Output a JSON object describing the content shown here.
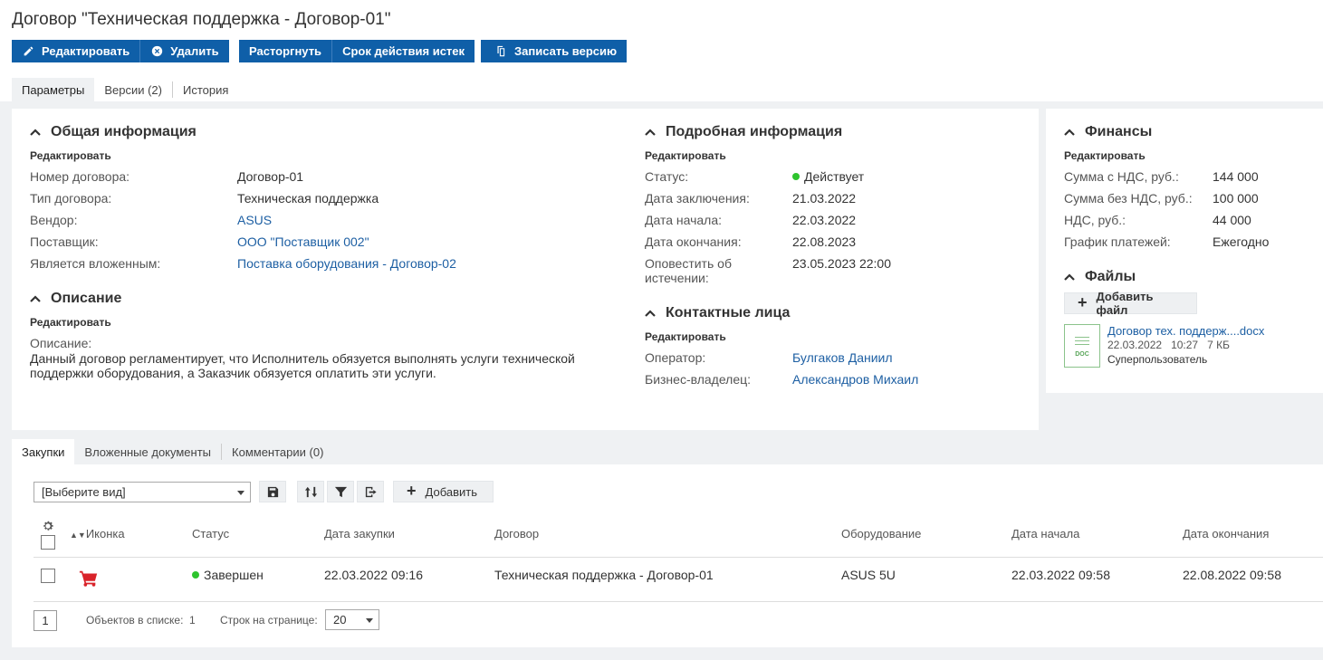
{
  "page": {
    "title": "Договор \"Техническая поддержка - Договор-01\""
  },
  "toolbar": {
    "edit": "Редактировать",
    "delete": "Удалить",
    "terminate": "Расторгнуть",
    "expired": "Срок действия истек",
    "save_version": "Записать версию"
  },
  "tabs": {
    "params": "Параметры",
    "versions": "Версии (2)",
    "history": "История"
  },
  "general": {
    "title": "Общая информация",
    "edit": "Редактировать",
    "rows": [
      {
        "label": "Номер договора:",
        "value": "Договор-01"
      },
      {
        "label": "Тип договора:",
        "value": "Техническая поддержка"
      },
      {
        "label": "Вендор:",
        "value": "ASUS"
      },
      {
        "label": "Поставщик:",
        "value": "ООО \"Поставщик 002\""
      },
      {
        "label": "Является вложенным:",
        "value": "Поставка оборудования - Договор-02"
      }
    ]
  },
  "description": {
    "title": "Описание",
    "edit": "Редактировать",
    "label": "Описание:",
    "text_line1": "Данный договор регламентирует, что Исполнитель обязуется выполнять услуги технической",
    "text_line2": "поддержки оборудования, а Заказчик обязуется оплатить эти услуги."
  },
  "details": {
    "title": "Подробная информация",
    "edit": "Редактировать",
    "rows": [
      {
        "label": "Статус:",
        "value": "Действует"
      },
      {
        "label": "Дата заключения:",
        "value": "21.03.2022"
      },
      {
        "label": "Дата начала:",
        "value": "22.03.2022"
      },
      {
        "label": "Дата окончания:",
        "value": "22.08.2023"
      },
      {
        "label": "Оповестить об",
        "label2": "истечении:",
        "value": "23.05.2023 22:00"
      }
    ],
    "status_color": "#2ec42e"
  },
  "contacts": {
    "title": "Контактные лица",
    "edit": "Редактировать",
    "rows": [
      {
        "label": "Оператор:",
        "value": "Булгаков Даниил"
      },
      {
        "label": "Бизнес-владелец:",
        "value": "Александров Михаил"
      }
    ]
  },
  "finance": {
    "title": "Финансы",
    "edit": "Редактировать",
    "rows": [
      {
        "label": "Сумма с НДС, руб.:",
        "value": "144 000"
      },
      {
        "label": "Сумма без НДС, руб.:",
        "value": "100 000"
      },
      {
        "label": "НДС, руб.:",
        "value": "44 000"
      },
      {
        "label": "График платежей:",
        "value": "Ежегодно"
      }
    ]
  },
  "files": {
    "title": "Файлы",
    "add_file": "Добавить файл",
    "file": {
      "icon_text": "DOC",
      "name": "Договор тех. поддерж....docx",
      "date": "22.03.2022",
      "time": "10:27",
      "size": "7 КБ",
      "author": "Суперпользователь"
    }
  },
  "bottom_tabs": {
    "purchases": "Закупки",
    "nested": "Вложенные документы",
    "comments": "Комментарии (0)"
  },
  "grid": {
    "view_placeholder": "[Выберите вид]",
    "add": "Добавить",
    "columns": {
      "icon": "Иконка",
      "status": "Статус",
      "date": "Дата закупки",
      "contract": "Договор",
      "equipment": "Оборудование",
      "start": "Дата начала",
      "end": "Дата окончания"
    },
    "row": {
      "status": "Завершен",
      "date": "22.03.2022 09:16",
      "contract": "Техническая поддержка - Договор-01",
      "equipment": "ASUS 5U",
      "start": "22.03.2022 09:58",
      "end": "22.08.2022 09:58"
    },
    "pager": {
      "page": "1",
      "objects_label": "Объектов в списке:",
      "objects_count": "1",
      "rows_label": "Строк на странице:",
      "rows_value": "20"
    }
  },
  "colors": {
    "primary": "#0f5fa8",
    "link": "#1d5fa3",
    "cart": "#d9232a"
  }
}
